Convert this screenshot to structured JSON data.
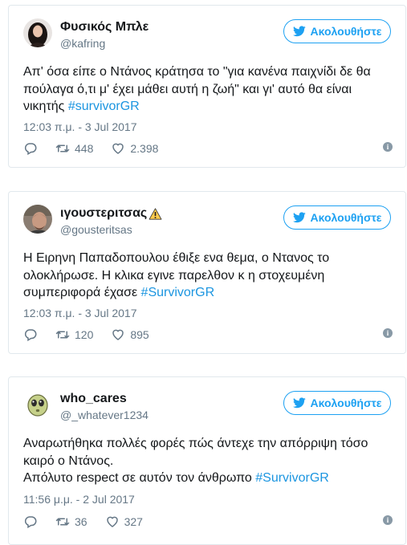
{
  "colors": {
    "accent": "#1da1f2",
    "hashtag": "#1b95e0",
    "muted": "#657786",
    "border": "#e1e8ed",
    "text": "#14171a"
  },
  "tweets": [
    {
      "display_name": "Φυσικός Μπλε",
      "handle": "@kafring",
      "follow_label": "Ακολουθήστε",
      "lines": [
        {
          "text": "Απ' όσα είπε ο Ντάνος κράτησα το \"για κανένα παιχνίδι δε θα",
          "hashtag": ""
        },
        {
          "text": "πούλαγα ό,τι μ' έχει μάθει αυτή η ζωή\" και γι' αυτό θα είναι",
          "hashtag": ""
        },
        {
          "text": "νικητής ",
          "hashtag": "#survivorGR"
        }
      ],
      "timestamp": "12:03 π.μ. - 3 Jul 2017",
      "retweets": "448",
      "likes": "2.398",
      "avatar_icon": "profile-photo-woman"
    },
    {
      "display_name": "ιγουστεριτσας",
      "handle": "@gousteritsas",
      "follow_label": "Ακολουθήστε",
      "lines": [
        {
          "text": "Η Ειρηνη Παπαδοπουλου έθιξε ενα θεμα, ο Ντανος το",
          "hashtag": ""
        },
        {
          "text": "ολοκλήρωσε. Η κλικα εγινε παρελθον κ η στοχευμένη",
          "hashtag": ""
        },
        {
          "text": "συμπεριφορά έχασε ",
          "hashtag": "#SurvivorGR"
        }
      ],
      "timestamp": "12:03 π.μ. - 3 Jul 2017",
      "retweets": "120",
      "likes": "895",
      "avatar_icon": "profile-photo-man",
      "badge_icon": "warning-icon"
    },
    {
      "display_name": "who_cares",
      "handle": "@_whatever1234",
      "follow_label": "Ακολουθήστε",
      "lines": [
        {
          "text": "Αναρωτήθηκα πολλές φορές πώς άντεχε την απόρριψη τόσο",
          "hashtag": ""
        },
        {
          "text": "καιρό ο Ντάνος.",
          "hashtag": ""
        },
        {
          "text": "Απόλυτο respect σε αυτόν τον άνθρωπο ",
          "hashtag": "#SurvivorGR"
        }
      ],
      "timestamp": "11:56 μ.μ. - 2 Jul 2017",
      "retweets": "36",
      "likes": "327",
      "avatar_icon": "alien-smiley-avatar"
    }
  ]
}
